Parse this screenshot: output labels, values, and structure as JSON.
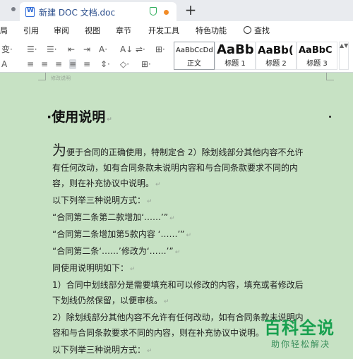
{
  "tabbar": {
    "doc_title": "新建 DOC 文档.doc",
    "new_tab": "+"
  },
  "menu": {
    "items": [
      "局",
      "引用",
      "审阅",
      "视图",
      "章节",
      "开发工具",
      "特色功能"
    ],
    "search_label": "查找"
  },
  "toolbar": {
    "row1": [
      "变·",
      "☰·",
      "☰·",
      "⇤",
      "⇥",
      "A·",
      "A↓",
      "⇌·",
      "⊞·"
    ],
    "row2": [
      "A",
      "≡",
      "≡",
      "≡",
      "≡",
      "≡",
      "⇕·",
      "◇·",
      "⊞·"
    ],
    "styles": [
      {
        "sample": "AaBbCcDd",
        "name": "正文"
      },
      {
        "sample": "AaBb",
        "name": "标题 1"
      },
      {
        "sample": "AaBb(",
        "name": "标题 2"
      },
      {
        "sample": "AaBbC",
        "name": "标题 3"
      }
    ],
    "gallery_scroll": "▲▼"
  },
  "document": {
    "header_crop": "修改说明",
    "heading": "使用说明",
    "paragraphs": [
      {
        "first": "为",
        "text": "便于合同的正确使用，特制定合 2）除划线部分其他内容不允许"
      },
      {
        "text": "有任何改动，如有合同条款未说明内容和与合同条款要求不同的内"
      },
      {
        "text": "容，则在补充协议中说明。"
      },
      {
        "text": "以下列举三种说明方式："
      },
      {
        "text": "“合同第二条第二款增加‘……’”"
      },
      {
        "text": "“合同第二条增加第5款内容 ‘……’”"
      },
      {
        "text": "“合同第二条‘……’修改为‘……’”"
      },
      {
        "text": "同使用说明明如下："
      },
      {
        "text": "1）合同中划线部分是需要填充和可以修改的内容，填充或者修改后"
      },
      {
        "text": "下划线仍然保留，以便审核。"
      },
      {
        "text": "2）除划线部分其他内容不允许有任何改动，如有合同条款未说明内"
      },
      {
        "text": "容和与合同条款要求不同的内容，则在补充协议中说明。"
      },
      {
        "text": "以下列举三种说明方式："
      }
    ],
    "para_mark": "↵"
  },
  "watermark": {
    "title": "百科全说",
    "subtitle": "助你轻松解决"
  }
}
